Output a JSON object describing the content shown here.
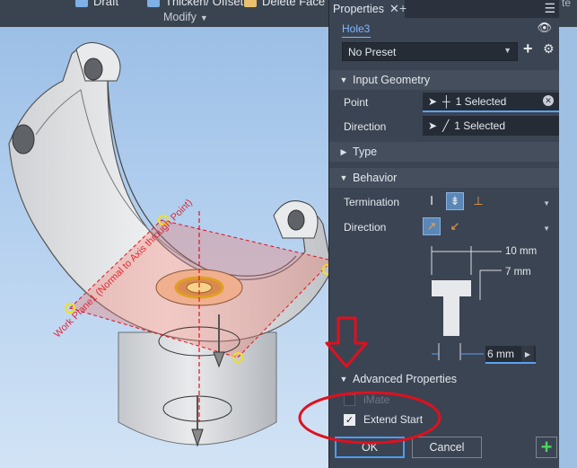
{
  "ribbon": {
    "items": [
      "Draft",
      "Thicken/ Offset",
      "Delete Face"
    ],
    "group_label": "Modify",
    "edge_text": "te"
  },
  "viewport": {
    "work_plane_label": "Work Plane1 (Normal to Axis through Point)"
  },
  "panel": {
    "tab_label": "Properties",
    "feature_name": "Hole3",
    "preset_value": "No Preset",
    "sections": {
      "input_geometry": "Input Geometry",
      "type": "Type",
      "behavior": "Behavior",
      "advanced": "Advanced Properties"
    },
    "point_label": "Point",
    "point_value": "1 Selected",
    "direction_label": "Direction",
    "direction_value": "1 Selected",
    "termination_label": "Termination",
    "behavior_direction_label": "Direction",
    "dims": {
      "top": "10 mm",
      "depth": "7 mm",
      "width_value": "6 mm"
    },
    "imate_label": "iMate",
    "imate_checked": false,
    "extend_start_label": "Extend Start",
    "extend_start_checked": true,
    "ok_label": "OK",
    "cancel_label": "Cancel"
  },
  "colors": {
    "annotation_red": "#e0101e",
    "panel_bg": "#3b4453",
    "accent_blue": "#5aa2f0",
    "link_blue": "#7fb7ff"
  }
}
